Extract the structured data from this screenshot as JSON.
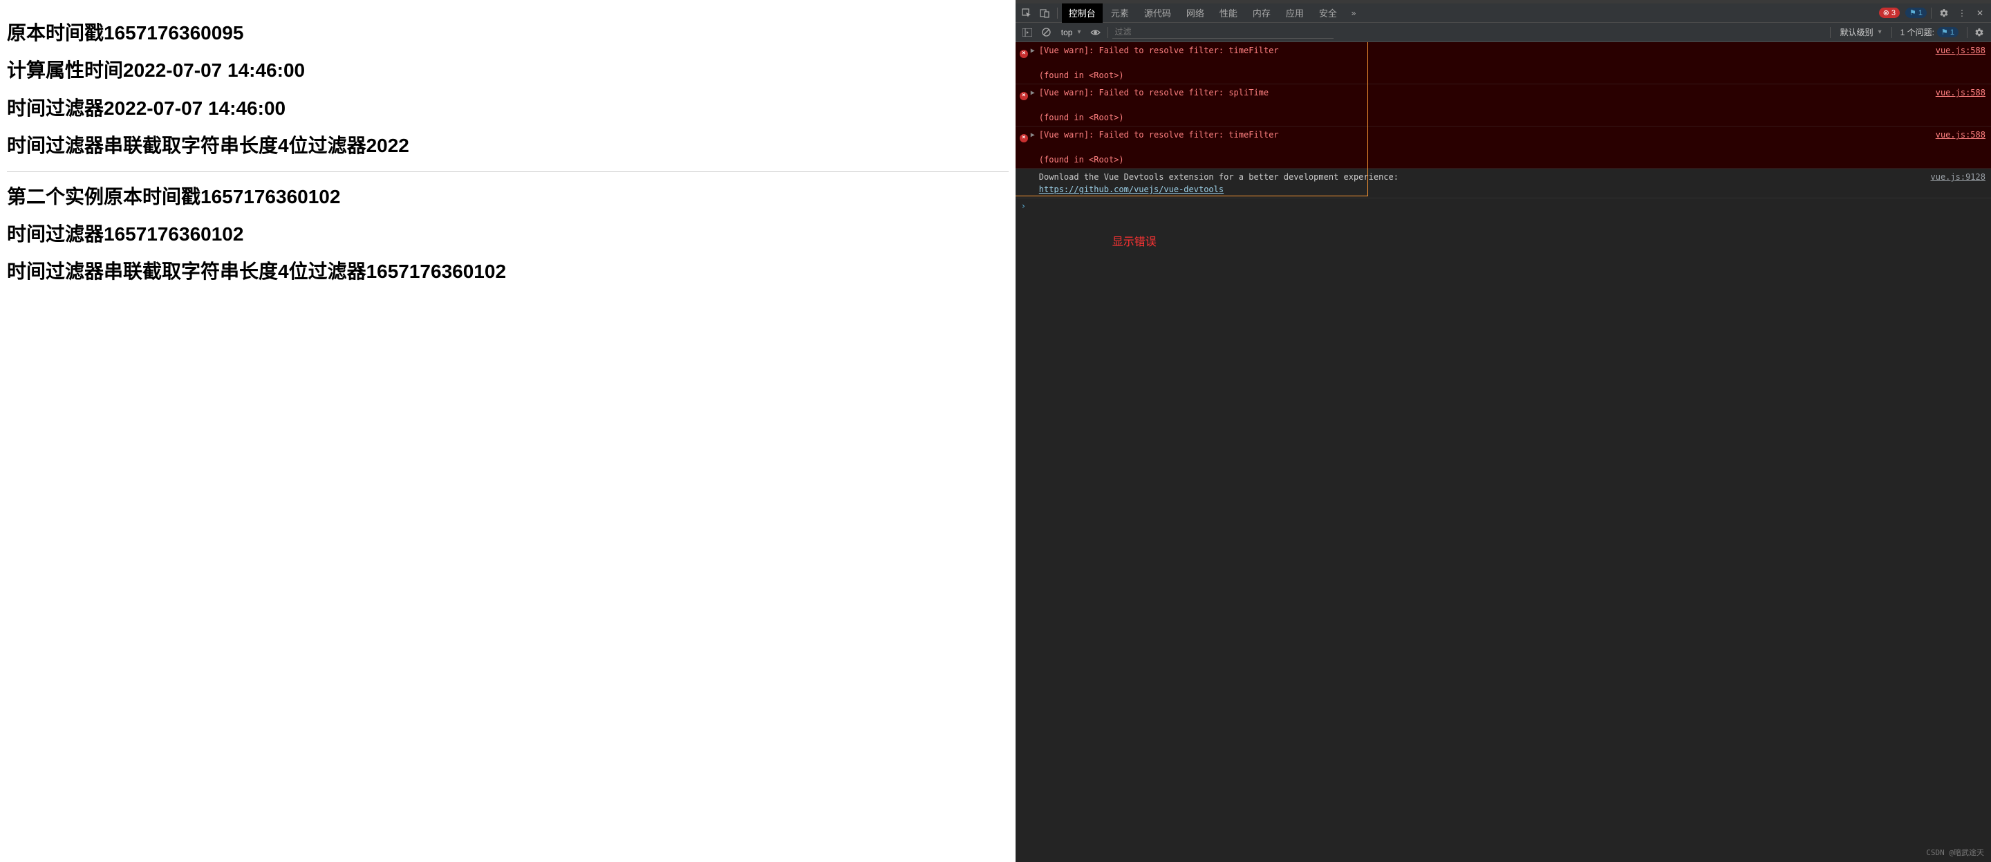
{
  "page": {
    "headings": [
      "原本时间戳1657176360095",
      "计算属性时间2022-07-07 14:46:00",
      "时间过滤器2022-07-07 14:46:00",
      "时间过滤器串联截取字符串长度4位过滤器2022"
    ],
    "headings2": [
      "第二个实例原本时间戳1657176360102",
      "时间过滤器1657176360102",
      "时间过滤器串联截取字符串长度4位过滤器1657176360102"
    ]
  },
  "devtools": {
    "tabs": [
      "控制台",
      "元素",
      "源代码",
      "网络",
      "性能",
      "内存",
      "应用",
      "安全"
    ],
    "error_count": "3",
    "info_count": "1",
    "toolbar": {
      "context": "top",
      "filter_placeholder": "过滤",
      "level": "默认级别",
      "issues_label": "1 个问题:",
      "issues_count": "1"
    },
    "logs": [
      {
        "type": "error",
        "msg": "[Vue warn]: Failed to resolve filter: timeFilter\n\n(found in <Root>)",
        "src": "vue.js:588"
      },
      {
        "type": "error",
        "msg": "[Vue warn]: Failed to resolve filter: spliTime\n\n(found in <Root>)",
        "src": "vue.js:588"
      },
      {
        "type": "error",
        "msg": "[Vue warn]: Failed to resolve filter: timeFilter\n\n(found in <Root>)",
        "src": "vue.js:588"
      },
      {
        "type": "info",
        "msg": "Download the Vue Devtools extension for a better development experience:",
        "link": "https://github.com/vuejs/vue-devtools",
        "src": "vue.js:9128"
      }
    ],
    "annotation": "显示错误"
  },
  "watermark": "CSDN @暗武途天"
}
